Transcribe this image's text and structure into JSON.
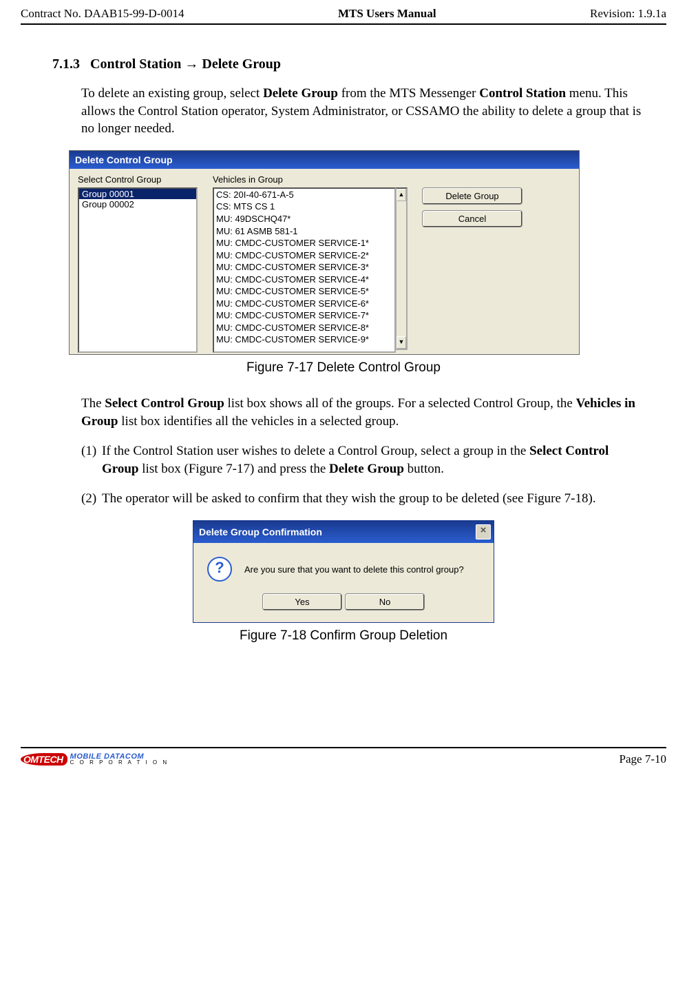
{
  "header": {
    "contract": "Contract No. DAAB15-99-D-0014",
    "title": "MTS Users Manual",
    "revision": "Revision:  1.9.1a"
  },
  "section": {
    "number": "7.1.3",
    "title_prefix": "Control Station ",
    "arrow": "→",
    "title_suffix": " Delete Group"
  },
  "para1": {
    "t1": "To delete an existing group, select ",
    "b1": "Delete Group",
    "t2": " from the MTS Messenger ",
    "b2": "Control Station",
    "t3": " menu.  This allows the Control Station operator, System Administrator, or CSSAMO the ability to delete a group that is no longer needed."
  },
  "dialog1": {
    "title": "Delete Control Group",
    "label_groups": "Select Control Group",
    "label_vehicles": "Vehicles in Group",
    "groups": [
      "Group 00001",
      "Group 00002"
    ],
    "vehicles": [
      "CS: 20I-40-671-A-5",
      "CS: MTS CS 1",
      "MU: 49DSCHQ47*",
      "MU: 61 ASMB 581-1",
      "MU: CMDC-CUSTOMER SERVICE-1*",
      "MU: CMDC-CUSTOMER SERVICE-2*",
      "MU: CMDC-CUSTOMER SERVICE-3*",
      "MU: CMDC-CUSTOMER SERVICE-4*",
      "MU: CMDC-CUSTOMER SERVICE-5*",
      "MU: CMDC-CUSTOMER SERVICE-6*",
      "MU: CMDC-CUSTOMER SERVICE-7*",
      "MU: CMDC-CUSTOMER SERVICE-8*",
      "MU: CMDC-CUSTOMER SERVICE-9*"
    ],
    "btn_delete": "Delete Group",
    "btn_cancel": "Cancel",
    "scroll_up": "▲",
    "scroll_down": "▼"
  },
  "fig17": "Figure 7-17   Delete Control Group",
  "para2": {
    "t1": "The ",
    "b1": "Select Control Group",
    "t2": " list box shows all of the groups.  For a selected Control Group, the ",
    "b2": "Vehicles in Group",
    "t3": " list box identifies all the vehicles in a selected group."
  },
  "step1": {
    "num": "(1)",
    "t1": "If the Control Station user wishes to delete a Control Group, select a group in the ",
    "b1": "Select Control Group",
    "t2": " list box (Figure 7-17) and press the ",
    "b2": "Delete Group",
    "t3": " button."
  },
  "step2": {
    "num": "(2)",
    "t1": "The operator will be asked to confirm that they wish the group to be deleted (see Figure 7-18)."
  },
  "dialog2": {
    "title": "Delete Group Confirmation",
    "close": "×",
    "qmark": "?",
    "msg": "Are you sure that you want to delete this control group?",
    "yes": "Yes",
    "no": "No"
  },
  "fig18": "Figure 7-18   Confirm Group Deletion",
  "footer": {
    "logo_c": "OMTECH",
    "logo_md": "MOBILE DATACOM",
    "logo_corp": "C O R P O R A T I O N",
    "page": "Page 7-10"
  }
}
